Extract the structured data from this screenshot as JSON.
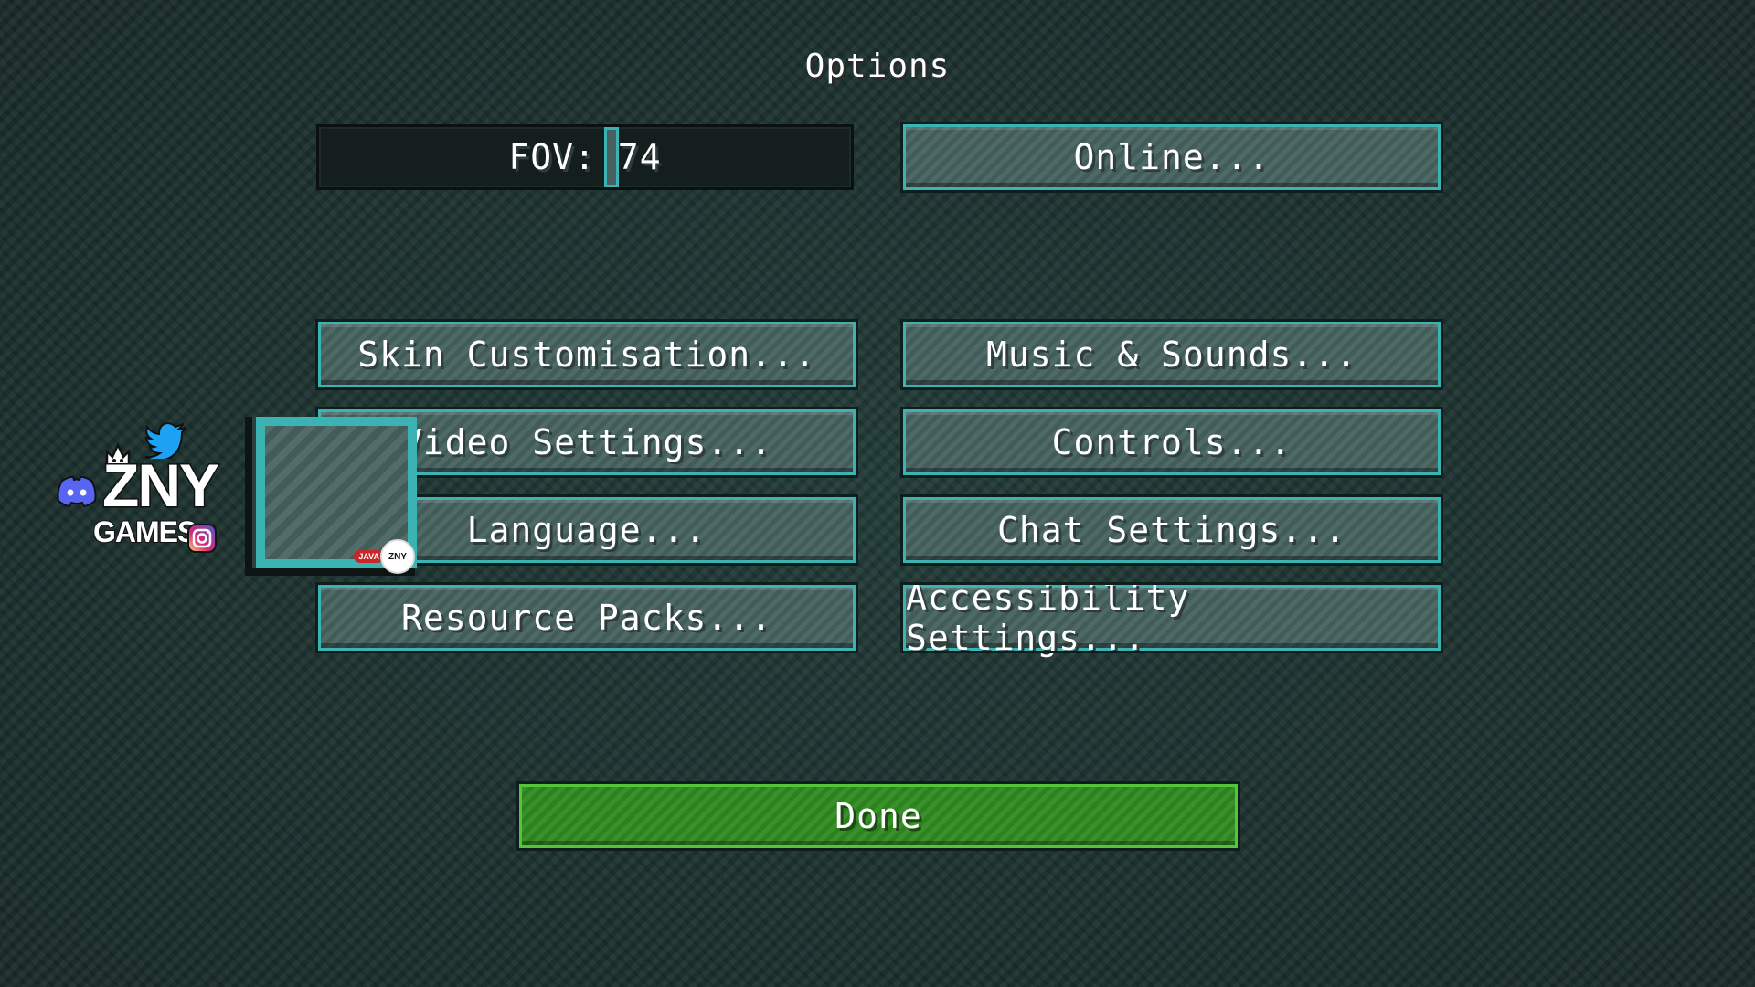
{
  "screen": {
    "title": "Options"
  },
  "fov": {
    "label": "FOV: 74",
    "value": 74
  },
  "buttons": {
    "online": "Online...",
    "skin": "Skin Customisation...",
    "music": "Music & Sounds...",
    "video": "Video Settings...",
    "controls": "Controls...",
    "language": "Language...",
    "chat": "Chat Settings...",
    "resource_packs": "Resource Packs...",
    "accessibility": "Accessibility Settings...",
    "done": "Done"
  },
  "watermark": {
    "logo_line1": "ZNY",
    "logo_line2": "GAMES",
    "badge_java": "JAVA",
    "badge_zny": "ZNY"
  },
  "colors": {
    "button_border": "#3bb3b3",
    "button_fill": "#46615f",
    "done_fill": "#2f8a1f",
    "background": "#1c3230"
  },
  "icons": [
    "discord-icon",
    "twitter-icon",
    "instagram-icon",
    "crown-icon"
  ]
}
